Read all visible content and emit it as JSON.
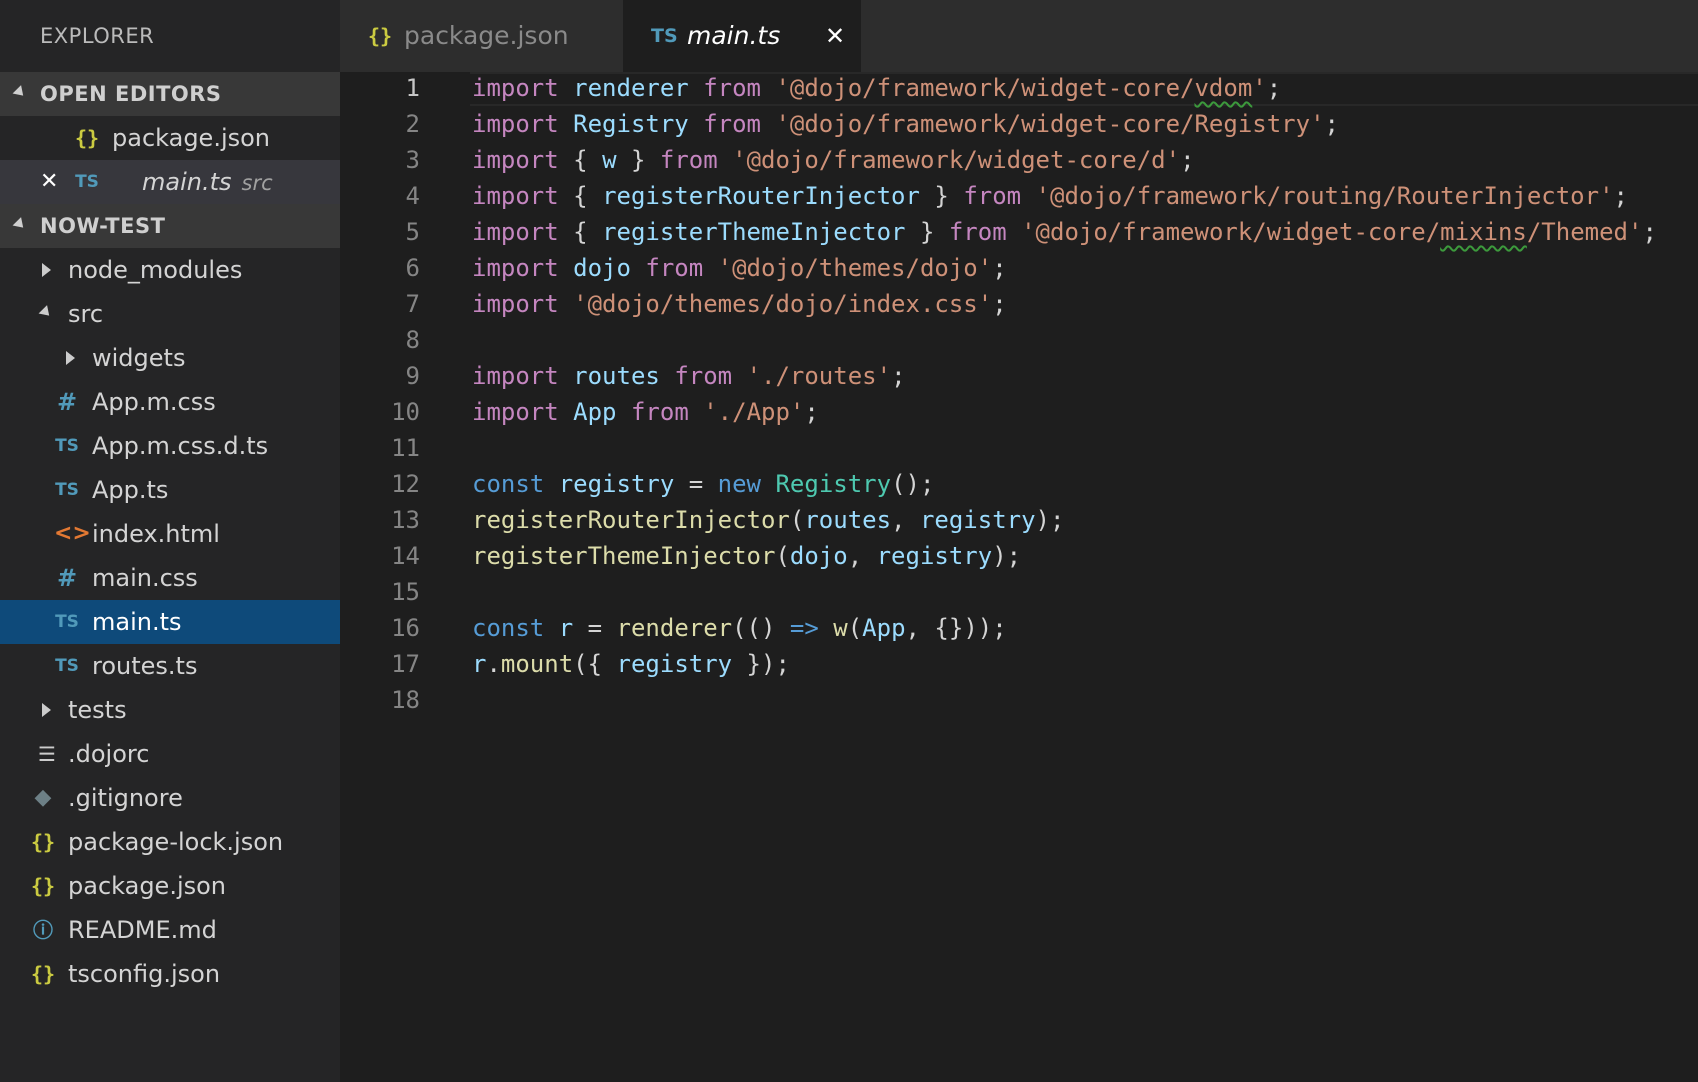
{
  "explorer": {
    "title": "EXPLORER",
    "open_editors": {
      "header": "OPEN EDITORS",
      "items": [
        {
          "label": "package.json",
          "icon": "json-icon"
        },
        {
          "label": "main.ts",
          "description": "src",
          "icon": "typescript-icon"
        }
      ]
    },
    "project": {
      "header": "NOW-TEST",
      "items": [
        {
          "label": "node_modules"
        },
        {
          "label": "src"
        },
        {
          "label": "widgets"
        },
        {
          "label": "App.m.css",
          "icon": "css-icon"
        },
        {
          "label": "App.m.css.d.ts",
          "icon": "typescript-icon"
        },
        {
          "label": "App.ts",
          "icon": "typescript-icon"
        },
        {
          "label": "index.html",
          "icon": "html-icon"
        },
        {
          "label": "main.css",
          "icon": "css-icon"
        },
        {
          "label": "main.ts",
          "icon": "typescript-icon"
        },
        {
          "label": "routes.ts",
          "icon": "typescript-icon"
        },
        {
          "label": "tests"
        },
        {
          "label": ".dojorc",
          "icon": "lines-icon"
        },
        {
          "label": ".gitignore",
          "icon": "git-icon"
        },
        {
          "label": "package-lock.json",
          "icon": "json-icon"
        },
        {
          "label": "package.json",
          "icon": "json-icon"
        },
        {
          "label": "README.md",
          "icon": "info-icon"
        },
        {
          "label": "tsconfig.json",
          "icon": "json-icon"
        }
      ]
    }
  },
  "icons": {
    "json": "{}",
    "ts": "TS",
    "css": "#",
    "html": "<>",
    "info": "ⓘ",
    "git": "◆",
    "lines": "☰",
    "close": "✕"
  },
  "tabs": [
    {
      "label": "package.json",
      "icon": "json-icon"
    },
    {
      "label": "main.ts",
      "icon": "typescript-icon"
    }
  ],
  "editor": {
    "line_numbers": [
      "1",
      "2",
      "3",
      "4",
      "5",
      "6",
      "7",
      "8",
      "9",
      "10",
      "11",
      "12",
      "13",
      "14",
      "15",
      "16",
      "17",
      "18"
    ],
    "lines": [
      [
        [
          "kw",
          "import"
        ],
        [
          "pun",
          " "
        ],
        [
          "var",
          "renderer"
        ],
        [
          "pun",
          " "
        ],
        [
          "kw",
          "from"
        ],
        [
          "pun",
          " "
        ],
        [
          "str",
          "'@dojo/framework/widget-core/"
        ],
        [
          "str squig",
          "vdom"
        ],
        [
          "str",
          "'"
        ],
        [
          "pun",
          ";"
        ]
      ],
      [
        [
          "kw",
          "import"
        ],
        [
          "pun",
          " "
        ],
        [
          "var",
          "Registry"
        ],
        [
          "pun",
          " "
        ],
        [
          "kw",
          "from"
        ],
        [
          "pun",
          " "
        ],
        [
          "str",
          "'@dojo/framework/widget-core/Registry'"
        ],
        [
          "pun",
          ";"
        ]
      ],
      [
        [
          "kw",
          "import"
        ],
        [
          "pun",
          " { "
        ],
        [
          "var",
          "w"
        ],
        [
          "pun",
          " } "
        ],
        [
          "kw",
          "from"
        ],
        [
          "pun",
          " "
        ],
        [
          "str",
          "'@dojo/framework/widget-core/d'"
        ],
        [
          "pun",
          ";"
        ]
      ],
      [
        [
          "kw",
          "import"
        ],
        [
          "pun",
          " { "
        ],
        [
          "var",
          "registerRouterInjector"
        ],
        [
          "pun",
          " } "
        ],
        [
          "kw",
          "from"
        ],
        [
          "pun",
          " "
        ],
        [
          "str",
          "'@dojo/framework/routing/RouterInjector'"
        ],
        [
          "pun",
          ";"
        ]
      ],
      [
        [
          "kw",
          "import"
        ],
        [
          "pun",
          " { "
        ],
        [
          "var",
          "registerThemeInjector"
        ],
        [
          "pun",
          " } "
        ],
        [
          "kw",
          "from"
        ],
        [
          "pun",
          " "
        ],
        [
          "str",
          "'@dojo/framework/widget-core/"
        ],
        [
          "str squig",
          "mixins"
        ],
        [
          "str",
          "/Themed'"
        ],
        [
          "pun",
          ";"
        ]
      ],
      [
        [
          "kw",
          "import"
        ],
        [
          "pun",
          " "
        ],
        [
          "var",
          "dojo"
        ],
        [
          "pun",
          " "
        ],
        [
          "kw",
          "from"
        ],
        [
          "pun",
          " "
        ],
        [
          "str",
          "'@dojo/themes/dojo'"
        ],
        [
          "pun",
          ";"
        ]
      ],
      [
        [
          "kw",
          "import"
        ],
        [
          "pun",
          " "
        ],
        [
          "str",
          "'@dojo/themes/dojo/index.css'"
        ],
        [
          "pun",
          ";"
        ]
      ],
      [],
      [
        [
          "kw",
          "import"
        ],
        [
          "pun",
          " "
        ],
        [
          "var",
          "routes"
        ],
        [
          "pun",
          " "
        ],
        [
          "kw",
          "from"
        ],
        [
          "pun",
          " "
        ],
        [
          "str",
          "'./routes'"
        ],
        [
          "pun",
          ";"
        ]
      ],
      [
        [
          "kw",
          "import"
        ],
        [
          "pun",
          " "
        ],
        [
          "var",
          "App"
        ],
        [
          "pun",
          " "
        ],
        [
          "kw",
          "from"
        ],
        [
          "pun",
          " "
        ],
        [
          "str",
          "'./App'"
        ],
        [
          "pun",
          ";"
        ]
      ],
      [],
      [
        [
          "decl",
          "const"
        ],
        [
          "pun",
          " "
        ],
        [
          "var",
          "registry"
        ],
        [
          "pun",
          " = "
        ],
        [
          "decl",
          "new"
        ],
        [
          "pun",
          " "
        ],
        [
          "cls",
          "Registry"
        ],
        [
          "pun",
          "();"
        ]
      ],
      [
        [
          "fn",
          "registerRouterInjector"
        ],
        [
          "pun",
          "("
        ],
        [
          "var",
          "routes"
        ],
        [
          "pun",
          ", "
        ],
        [
          "var",
          "registry"
        ],
        [
          "pun",
          ");"
        ]
      ],
      [
        [
          "fn",
          "registerThemeInjector"
        ],
        [
          "pun",
          "("
        ],
        [
          "var",
          "dojo"
        ],
        [
          "pun",
          ", "
        ],
        [
          "var",
          "registry"
        ],
        [
          "pun",
          ");"
        ]
      ],
      [],
      [
        [
          "decl",
          "const"
        ],
        [
          "pun",
          " "
        ],
        [
          "var",
          "r"
        ],
        [
          "pun",
          " = "
        ],
        [
          "fn",
          "renderer"
        ],
        [
          "pun",
          "(() "
        ],
        [
          "decl",
          "=>"
        ],
        [
          "pun",
          " "
        ],
        [
          "fn",
          "w"
        ],
        [
          "pun",
          "("
        ],
        [
          "var",
          "App"
        ],
        [
          "pun",
          ", {}));"
        ]
      ],
      [
        [
          "var",
          "r"
        ],
        [
          "pun",
          "."
        ],
        [
          "fn",
          "mount"
        ],
        [
          "pun",
          "({ "
        ],
        [
          "var",
          "registry"
        ],
        [
          "pun",
          " });"
        ]
      ],
      []
    ]
  }
}
